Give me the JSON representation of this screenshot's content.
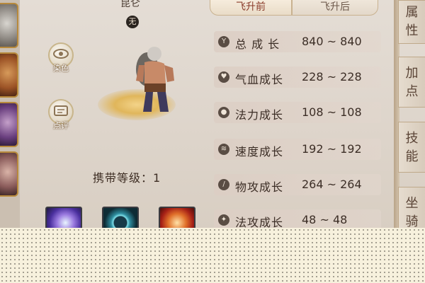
{
  "character": {
    "name": "昆仑",
    "badge": "无",
    "carry_level_label": "携带等级：",
    "carry_level_value": "1"
  },
  "side_buttons": [
    {
      "label": "染色",
      "icon": "eye-icon"
    },
    {
      "label": "点评",
      "icon": "comment-icon"
    }
  ],
  "tabs": [
    {
      "label": "飞升前",
      "active": true
    },
    {
      "label": "飞升后",
      "active": false
    }
  ],
  "stats": [
    {
      "icon": "total-growth-icon",
      "glyph": "Y",
      "label": "总 成 长",
      "value": "840 ~ 840"
    },
    {
      "icon": "heart-icon",
      "glyph": "♥",
      "label": "气血成长",
      "value": "228 ~ 228"
    },
    {
      "icon": "mana-drop-icon",
      "glyph": "●",
      "label": "法力成长",
      "value": "108 ~ 108"
    },
    {
      "icon": "speed-icon",
      "glyph": "≋",
      "label": "速度成长",
      "value": "192 ~ 192"
    },
    {
      "icon": "physical-attack-icon",
      "glyph": "/",
      "label": "物攻成长",
      "value": "264 ~ 264"
    },
    {
      "icon": "magic-attack-icon",
      "glyph": "✦",
      "label": "法攻成长",
      "value": "48 ~ 48"
    }
  ],
  "right_tabs": [
    {
      "label": "属性"
    },
    {
      "label": "加点"
    },
    {
      "label": "技能"
    },
    {
      "label": "坐骑"
    }
  ],
  "colors": {
    "tab_active_text": "#8a3b2a",
    "frame_gold": "#b88a3c"
  }
}
